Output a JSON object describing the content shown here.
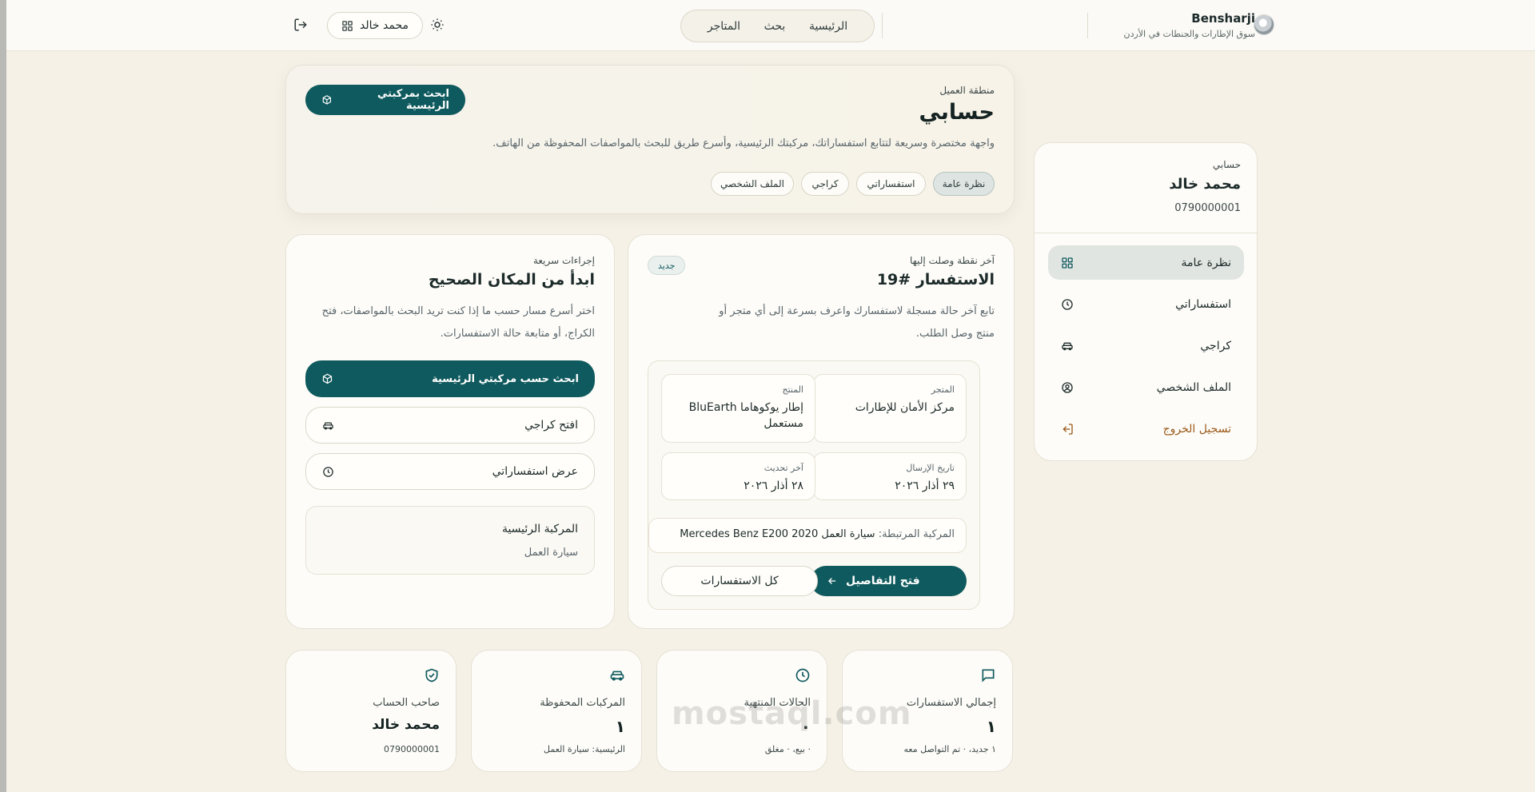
{
  "header": {
    "brand_name": "Bensharji",
    "brand_sub": "سوق الإطارات والجنطات في الأردن",
    "nav": [
      "الرئيسية",
      "بحث",
      "المتاجر"
    ],
    "user_name": "محمد خالد"
  },
  "hero": {
    "eyebrow": "منطقة العميل",
    "title": "حسابي",
    "description": "واجهة مختصرة وسريعة لتتابع استفساراتك، مركبتك الرئيسية، وأسرع طريق للبحث بالمواصفات المحفوظة من الهاتف.",
    "search_button": "ابحث بمركبتي الرئيسية",
    "chips": [
      "نظرة عامة",
      "استفساراتي",
      "كراجي",
      "الملف الشخصي"
    ]
  },
  "sidebar": {
    "eyebrow": "حسابي",
    "name": "محمد خالد",
    "phone": "0790000001",
    "items": [
      {
        "label": "نظرة عامة",
        "icon": "grid-icon"
      },
      {
        "label": "استفساراتي",
        "icon": "clock-icon"
      },
      {
        "label": "كراجي",
        "icon": "car-icon"
      },
      {
        "label": "الملف الشخصي",
        "icon": "user-circle-icon"
      },
      {
        "label": "تسجيل الخروج",
        "icon": "logout-icon"
      }
    ]
  },
  "inquiry": {
    "eyebrow": "آخر نقطة وصلت إليها",
    "title": "الاستفسار #19",
    "badge": "جديد",
    "description": "تابع آخر حالة مسجلة لاستفسارك واعرف بسرعة إلى أي متجر أو منتج وصل الطلب.",
    "store_label": "المتجر",
    "store_value": "مركز الأمان للإطارات",
    "product_label": "المنتج",
    "product_value": "إطار يوكوهاما BluEarth مستعمل",
    "sent_label": "تاريخ الإرسال",
    "sent_value": "٢٩ أذار ٢٠٢٦",
    "updated_label": "آخر تحديث",
    "updated_value": "٢٨ أذار ٢٠٢٦",
    "vehicle_label": "المركبة المرتبطة:",
    "vehicle_value": "سيارة العمل Mercedes Benz E200 2020",
    "open_button": "فتح التفاصيل",
    "all_button": "كل الاستفسارات"
  },
  "quick": {
    "eyebrow": "إجراءات سريعة",
    "title": "ابدأ من المكان الصحيح",
    "description": "اختر أسرع مسار حسب ما إذا كنت تريد البحث بالمواصفات، فتح الكراج، أو متابعة حالة الاستفسارات.",
    "primary_button": "ابحث حسب مركبتي الرئيسية",
    "garage_button": "افتح كراجي",
    "inquiries_button": "عرض استفساراتي",
    "vehicle_title": "المركبة الرئيسية",
    "vehicle_value": "سيارة العمل"
  },
  "stats": [
    {
      "label": "إجمالي الاستفسارات",
      "value": "١",
      "sub": "١ جديد، · تم التواصل معه",
      "icon": "chat-icon"
    },
    {
      "label": "الحالات المنتهية",
      "value": "٠",
      "sub": "· بيع، · مغلق",
      "icon": "clock-icon"
    },
    {
      "label": "المركبات المحفوظة",
      "value": "١",
      "sub": "الرئيسية: سيارة العمل",
      "icon": "car-icon"
    },
    {
      "label": "صاحب الحساب",
      "value": "محمد خالد",
      "sub": "0790000001",
      "icon": "shield-check-icon"
    }
  ],
  "watermark": "mostaql.com",
  "colors": {
    "accent": "#0f5a5e",
    "background": "#f5f1e7",
    "logout": "#9a5a1c"
  }
}
